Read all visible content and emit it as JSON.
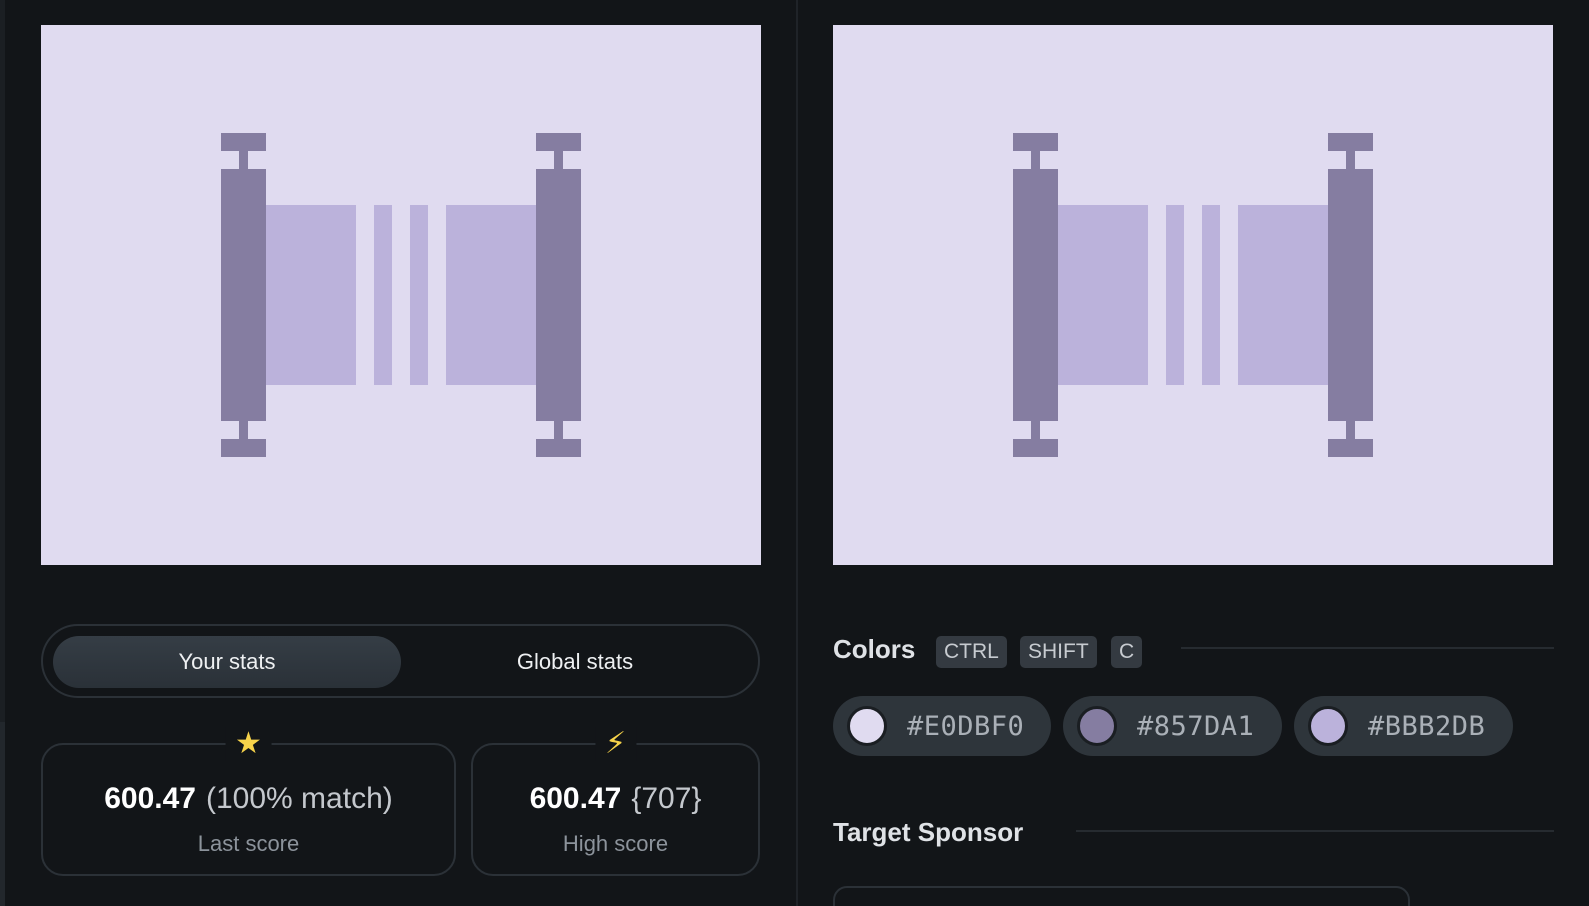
{
  "stats": {
    "tab_yours": "Your stats",
    "tab_global": "Global stats"
  },
  "last_score": {
    "icon": "star-icon",
    "icon_glyph": "★",
    "value": "600.47",
    "extra": "(100% match)",
    "label": "Last score"
  },
  "high_score": {
    "icon": "lightning-icon",
    "icon_glyph": "⚡",
    "value": "600.47",
    "extra": "{707}",
    "label": "High score"
  },
  "colors": {
    "title": "Colors",
    "shortcut": [
      "CTRL",
      "SHIFT",
      "C"
    ],
    "items": [
      {
        "hex": "#E0DBF0",
        "color": "#E0DBF0"
      },
      {
        "hex": "#857DA1",
        "color": "#857DA1"
      },
      {
        "hex": "#BBB2DB",
        "color": "#BBB2DB"
      }
    ]
  },
  "sponsor": {
    "title": "Target Sponsor"
  },
  "palette": {
    "background": "#E0DBF0",
    "dark": "#857DA1",
    "light": "#BBB2DB",
    "accent": "#F7D34A"
  }
}
